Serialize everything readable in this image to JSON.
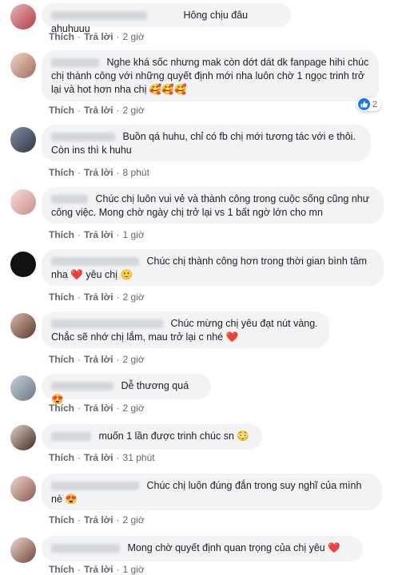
{
  "actions": {
    "like": "Thích",
    "reply": "Trả lời",
    "separator": "·"
  },
  "comments": [
    {
      "text": "Hông chịu đâu ahuhuuu",
      "time": "2 giờ"
    },
    {
      "text": "Nghe khá sốc nhưng mak còn dớt dát dk fanpage hihi chúc chị thành công với những quyết định mới nha luôn chờ 1 ngọc trinh trở lại và hot hơn nha chị 🥰🥰🥰",
      "time": "2 giờ",
      "reaction_count": "2"
    },
    {
      "text": "Buồn qá huhu, chỉ có fb chị mới tương tác với e thôi. Còn ins thì k huhu",
      "time": "8 phút"
    },
    {
      "text": "Chúc chị luôn vui vẻ và thành công trong cuộc sống cũng như công việc. Mong chờ ngày chị trở lại vs 1 bất ngờ lớn cho mn",
      "time": "1 giờ"
    },
    {
      "text": "Chúc chị thành công hơn trong thời gian bình tâm nha ❤️ yêu chị 🙂",
      "time": "2 giờ"
    },
    {
      "text": "Chúc mừng chị yêu đạt nút vàng. Chắc sẽ nhớ chị lắm, mau trở lại c nhé ❤️",
      "time": "2 giờ"
    },
    {
      "text": "Dễ thương quá 😍",
      "time": "2 giờ"
    },
    {
      "text": "muốn 1 lần được trinh chúc sn 😳",
      "time": "31 phút"
    },
    {
      "text": "Chúc chị luôn đúng đắn trong suy nghĩ của mình nè 😍",
      "time": "2 giờ"
    },
    {
      "text": "Mong chờ quyết định quan trọng của chị yêu ❤️",
      "time": "1 giờ"
    }
  ],
  "colors": {
    "bubble": "#f2f3f5",
    "action_text": "#606770",
    "like_blue": "#1877f2",
    "heart": "#e0245e"
  }
}
